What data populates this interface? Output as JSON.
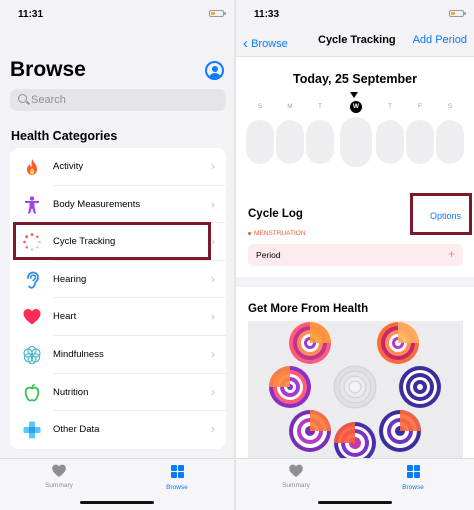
{
  "left": {
    "status": {
      "time": "11:31"
    },
    "title": "Browse",
    "search": {
      "placeholder": "Search"
    },
    "section_title": "Health Categories",
    "categories": [
      {
        "label": "Activity",
        "icon": "flame-icon"
      },
      {
        "label": "Body Measurements",
        "icon": "person-icon"
      },
      {
        "label": "Cycle Tracking",
        "icon": "cycle-dots-icon"
      },
      {
        "label": "Hearing",
        "icon": "ear-icon"
      },
      {
        "label": "Heart",
        "icon": "heart-icon"
      },
      {
        "label": "Mindfulness",
        "icon": "flower-icon"
      },
      {
        "label": "Nutrition",
        "icon": "apple-icon"
      },
      {
        "label": "Other Data",
        "icon": "plus-cross-icon"
      }
    ],
    "tabs": [
      {
        "label": "Summary",
        "active": false
      },
      {
        "label": "Browse",
        "active": true
      }
    ]
  },
  "right": {
    "status": {
      "time": "11:33"
    },
    "nav": {
      "back": "Browse",
      "title": "Cycle Tracking",
      "action": "Add Period"
    },
    "date_title": "Today, 25 September",
    "days": [
      "S",
      "M",
      "T",
      "W",
      "T",
      "F",
      "S"
    ],
    "selected_day_index": 3,
    "cycle_log": {
      "title": "Cycle Log",
      "options": "Options",
      "category": "MENSTRUATION",
      "item": "Period",
      "add": "+"
    },
    "more": {
      "title": "Get More From Health"
    },
    "tabs": [
      {
        "label": "Summary",
        "active": false
      },
      {
        "label": "Browse",
        "active": true
      }
    ]
  },
  "colors": {
    "accent": "#0a7aff",
    "highlight_box": "#7a1a2a",
    "menstruation": "#ef5b2e",
    "period_row": "#fdecee",
    "inactive_tab": "#8e8e93"
  }
}
